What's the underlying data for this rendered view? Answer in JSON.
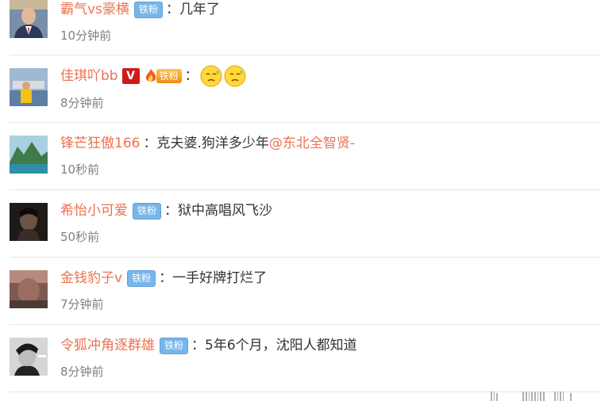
{
  "colors": {
    "username": "#eb7350",
    "text": "#333333",
    "time": "#808080",
    "badge": "#78b6ea",
    "vip": "#cc1b1b"
  },
  "comments": [
    {
      "username": "霸气vs豪横",
      "badge": "铁粉",
      "colon": "：",
      "text": "几年了",
      "time": "10分钟前",
      "avatar_icon": "man-in-suit-avatar"
    },
    {
      "username": "佳琪吖bb",
      "vip_badge": "V",
      "badge": "铁粉",
      "colon": "：",
      "emoji": [
        "sweat-face-icon",
        "sweat-face-icon"
      ],
      "time": "8分钟前",
      "avatar_icon": "boat-harbor-avatar"
    },
    {
      "username": "锋芒狂傲166",
      "colon": "：",
      "text": "克夫婆.狗洋多少年",
      "mention": "@东北全智贤-",
      "time": "10秒前",
      "avatar_icon": "mountain-lake-avatar"
    },
    {
      "username": "希怡小可爱",
      "badge": "铁粉",
      "colon": "：",
      "text": "狱中高唱风飞沙",
      "time": "50秒前",
      "avatar_icon": "dark-portrait-avatar"
    },
    {
      "username": "金钱豹子v",
      "badge": "铁粉",
      "colon": "：",
      "text": "一手好牌打烂了",
      "time": "7分钟前",
      "avatar_icon": "blurred-photo-avatar"
    },
    {
      "username": "令狐冲角逐群雄",
      "badge": "铁粉",
      "colon": "：",
      "text": "5年6个月，沈阳人都知道",
      "time": "8分钟前",
      "avatar_icon": "black-white-portrait-avatar"
    }
  ]
}
